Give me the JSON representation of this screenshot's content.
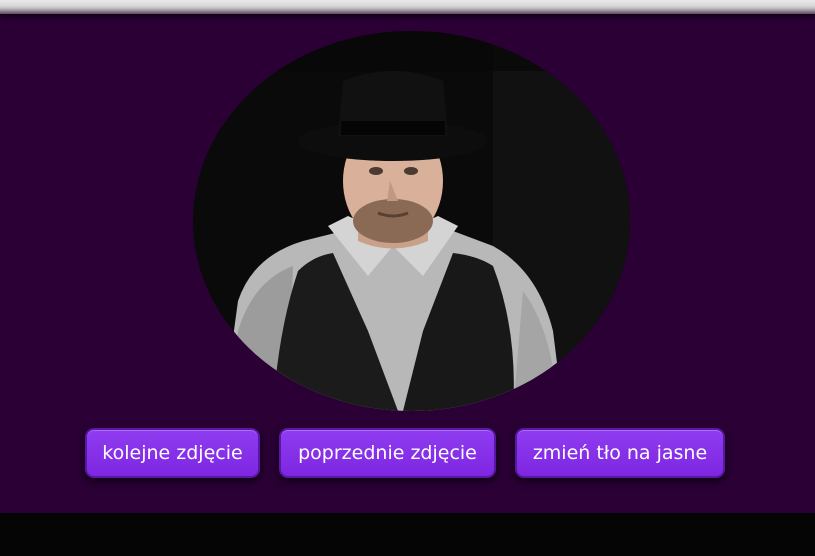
{
  "photo": {
    "alt": "portrait photo",
    "shape": "oval"
  },
  "buttons": {
    "next_label": "kolejne zdjęcie",
    "prev_label": "poprzednie zdjęcie",
    "theme_label": "zmień tło na jasne"
  },
  "footer": {
    "text": ""
  },
  "colors": {
    "background": "#2a0035",
    "button": "#8f3cf0",
    "button_border": "#5a16a5",
    "footer": "#050505",
    "top_bar": "#d9d9d9"
  }
}
